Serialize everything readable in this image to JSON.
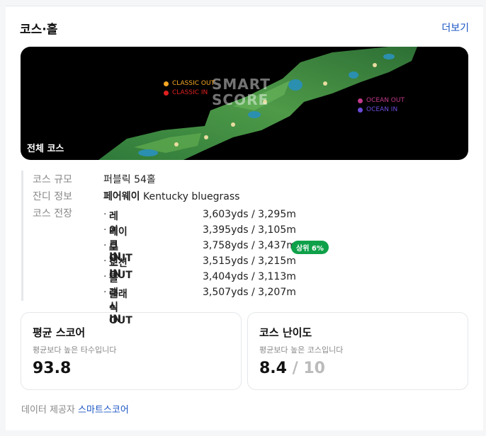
{
  "header": {
    "title": "코스·홀",
    "more_label": "더보기"
  },
  "map": {
    "caption": "전체 코스",
    "watermark_line1": "SMART",
    "watermark_line2": "SCORE",
    "legend_left": [
      {
        "label": "CLASSIC  OUT",
        "color": "#f5a623"
      },
      {
        "label": "CLASSIC  IN",
        "color": "#e02020"
      }
    ],
    "legend_right": [
      {
        "label": "OCEAN  OUT",
        "color": "#c0398b"
      },
      {
        "label": "OCEAN  IN",
        "color": "#6a4bd8"
      }
    ]
  },
  "info": {
    "scale_label": "코스 규모",
    "scale_value": "퍼블릭 54홀",
    "grass_label": "잔디 정보",
    "grass_strong": "페어웨이",
    "grass_value": " Kentucky bluegrass",
    "length_label": "코스 전장",
    "lengths": [
      {
        "name": "레이크IN",
        "dist": "3,603yds / 3,295m",
        "badge": ""
      },
      {
        "name": "레이크OUT",
        "dist": "3,395yds / 3,105m",
        "badge": ""
      },
      {
        "name": "오션IN",
        "dist": "3,758yds / 3,437m",
        "badge": "상위 6%"
      },
      {
        "name": "오션OUT",
        "dist": "3,515yds / 3,215m",
        "badge": ""
      },
      {
        "name": "클래식IN",
        "dist": "3,404yds / 3,113m",
        "badge": ""
      },
      {
        "name": "클래식OUT",
        "dist": "3,507yds / 3,207m",
        "badge": ""
      }
    ]
  },
  "stats": {
    "avg": {
      "title": "평균 스코어",
      "sub": "평균보다 높은 타수입니다",
      "value": "93.8"
    },
    "difficulty": {
      "title": "코스 난이도",
      "sub": "평균보다 높은 코스입니다",
      "value": "8.4",
      "total": "/ 10"
    }
  },
  "footer": {
    "label": "데이터 제공자 ",
    "link": "스마트스코어"
  },
  "colors": {
    "badge": "#0fa14a",
    "link": "#1a55c4"
  }
}
